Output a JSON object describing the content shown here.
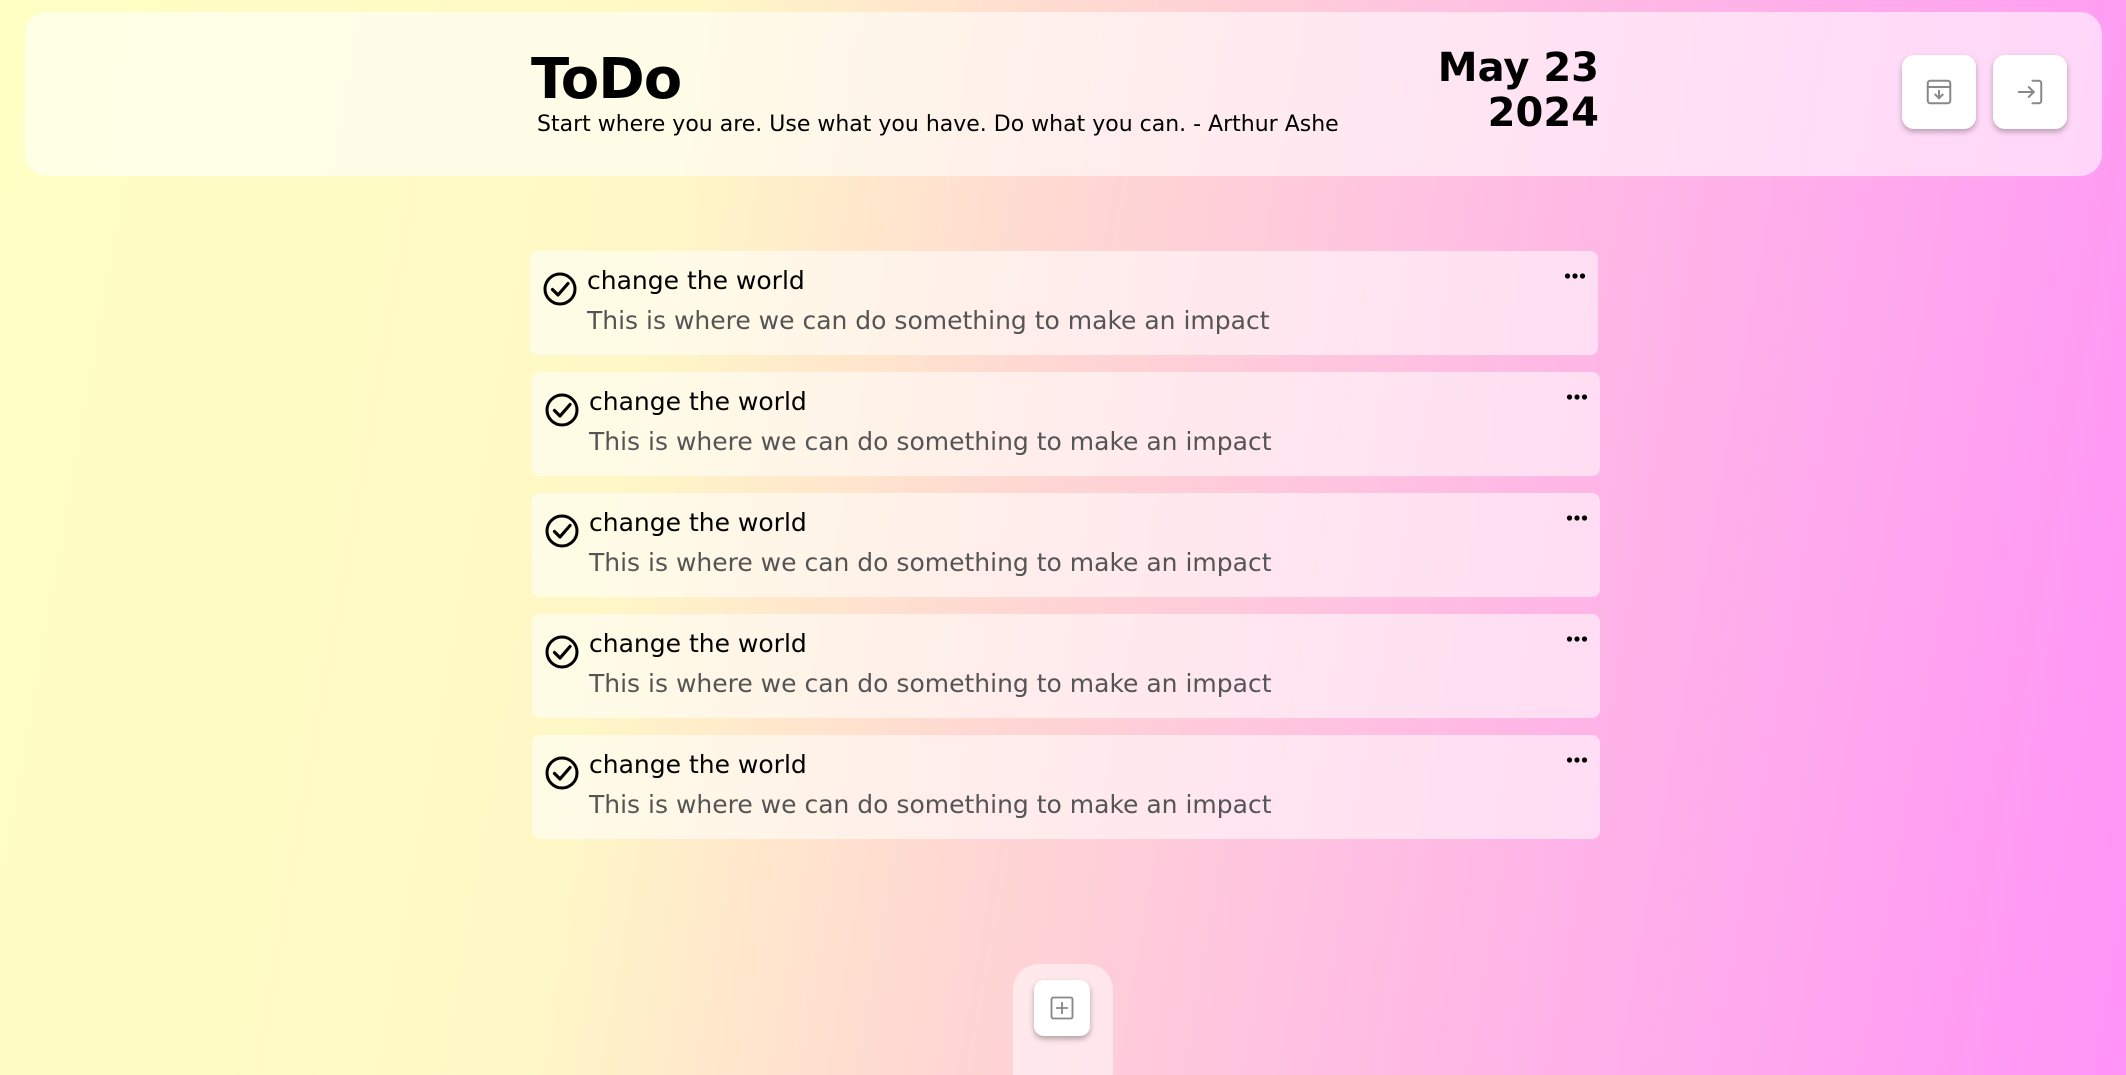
{
  "header": {
    "title": "ToDo",
    "quote": "Start where you are. Use what you have. Do what you can. - Arthur Ashe",
    "date_line1": "May 23",
    "date_line2": "2024",
    "buttons": [
      {
        "icon": "archive-download-icon"
      },
      {
        "icon": "sign-in-icon"
      }
    ]
  },
  "todos": [
    {
      "title": "change the world",
      "description": "This is where we can do something to make an impact",
      "completed": true
    },
    {
      "title": "change the world",
      "description": "This is where we can do something to make an impact",
      "completed": true
    },
    {
      "title": "change the world",
      "description": "This is where we can do something to make an impact",
      "completed": true
    },
    {
      "title": "change the world",
      "description": "This is where we can do something to make an impact",
      "completed": true
    },
    {
      "title": "change the world",
      "description": "This is where we can do something to make an impact",
      "completed": true
    }
  ],
  "add_button": {
    "icon": "plus-square-icon"
  },
  "colors": {
    "gradient_start": "#ffffc4",
    "gradient_end": "#ff93f7",
    "muted_text": "#555555"
  }
}
